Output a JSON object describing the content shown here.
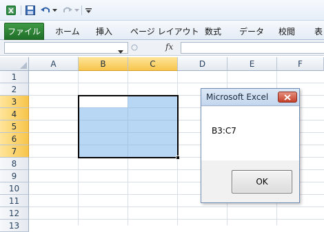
{
  "qat": {
    "icons": [
      "excel-logo-icon",
      "save-icon",
      "undo-icon",
      "redo-icon",
      "customize-icon"
    ]
  },
  "ribbon": {
    "file_tab": "ファイル",
    "tabs": [
      "ホーム",
      "挿入",
      "ページ レイアウト",
      "数式",
      "データ",
      "校閲",
      "表"
    ]
  },
  "formula_bar": {
    "name_box_value": "",
    "fx_label": "fx",
    "formula_value": ""
  },
  "sheet": {
    "columns": [
      "A",
      "B",
      "C",
      "D",
      "E",
      "F"
    ],
    "rows": [
      "1",
      "2",
      "3",
      "4",
      "5",
      "6",
      "7",
      "8",
      "9",
      "10",
      "11",
      "12",
      "13"
    ],
    "selected_range": "B3:C7",
    "selected_columns": [
      "B",
      "C"
    ],
    "selected_rows": [
      "3",
      "4",
      "5",
      "6",
      "7"
    ]
  },
  "dialog": {
    "title": "Microsoft Excel",
    "message": "B3:C7",
    "ok_label": "OK"
  },
  "colors": {
    "file_tab": "#2a7e33",
    "selection_fill": "#b8d7f5",
    "header_highlight": "#f7c54c",
    "close_button": "#c4402a"
  }
}
